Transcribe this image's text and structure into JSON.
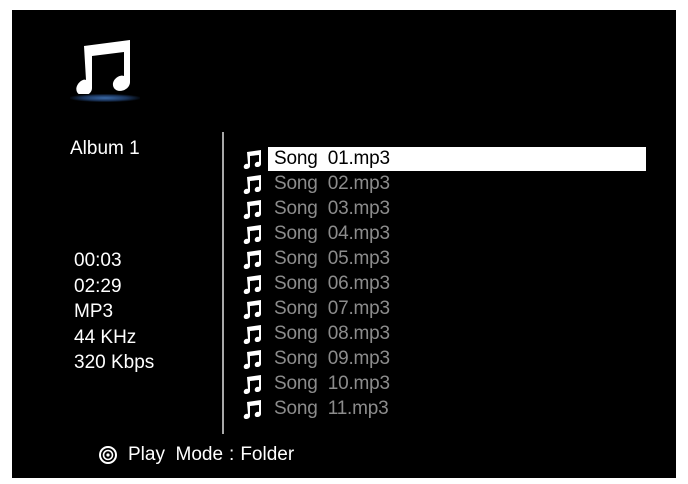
{
  "header": {
    "icon": "music-note-icon"
  },
  "album": {
    "title": "Album 1"
  },
  "track_info": {
    "elapsed": "00:03",
    "duration": "02:29",
    "format": "MP3",
    "sample_rate": "44 KHz",
    "bitrate": "320 Kbps"
  },
  "songs": [
    {
      "name": "Song  01.mp3",
      "selected": true
    },
    {
      "name": "Song  02.mp3",
      "selected": false
    },
    {
      "name": "Song  03.mp3",
      "selected": false
    },
    {
      "name": "Song  04.mp3",
      "selected": false
    },
    {
      "name": "Song  05.mp3",
      "selected": false
    },
    {
      "name": "Song  06.mp3",
      "selected": false
    },
    {
      "name": "Song  07.mp3",
      "selected": false
    },
    {
      "name": "Song  08.mp3",
      "selected": false
    },
    {
      "name": "Song  09.mp3",
      "selected": false
    },
    {
      "name": "Song  10.mp3",
      "selected": false
    },
    {
      "name": "Song  11.mp3",
      "selected": false
    }
  ],
  "footer": {
    "icon": "play-mode-icon",
    "play_mode_label": "Play  Mode",
    "separator": ":",
    "play_mode_value": "Folder"
  },
  "colors": {
    "background": "#000000",
    "text": "#ffffff",
    "inactive_text": "#8c8c8c",
    "selection": "#ffffff",
    "divider": "#a8a8a8"
  }
}
